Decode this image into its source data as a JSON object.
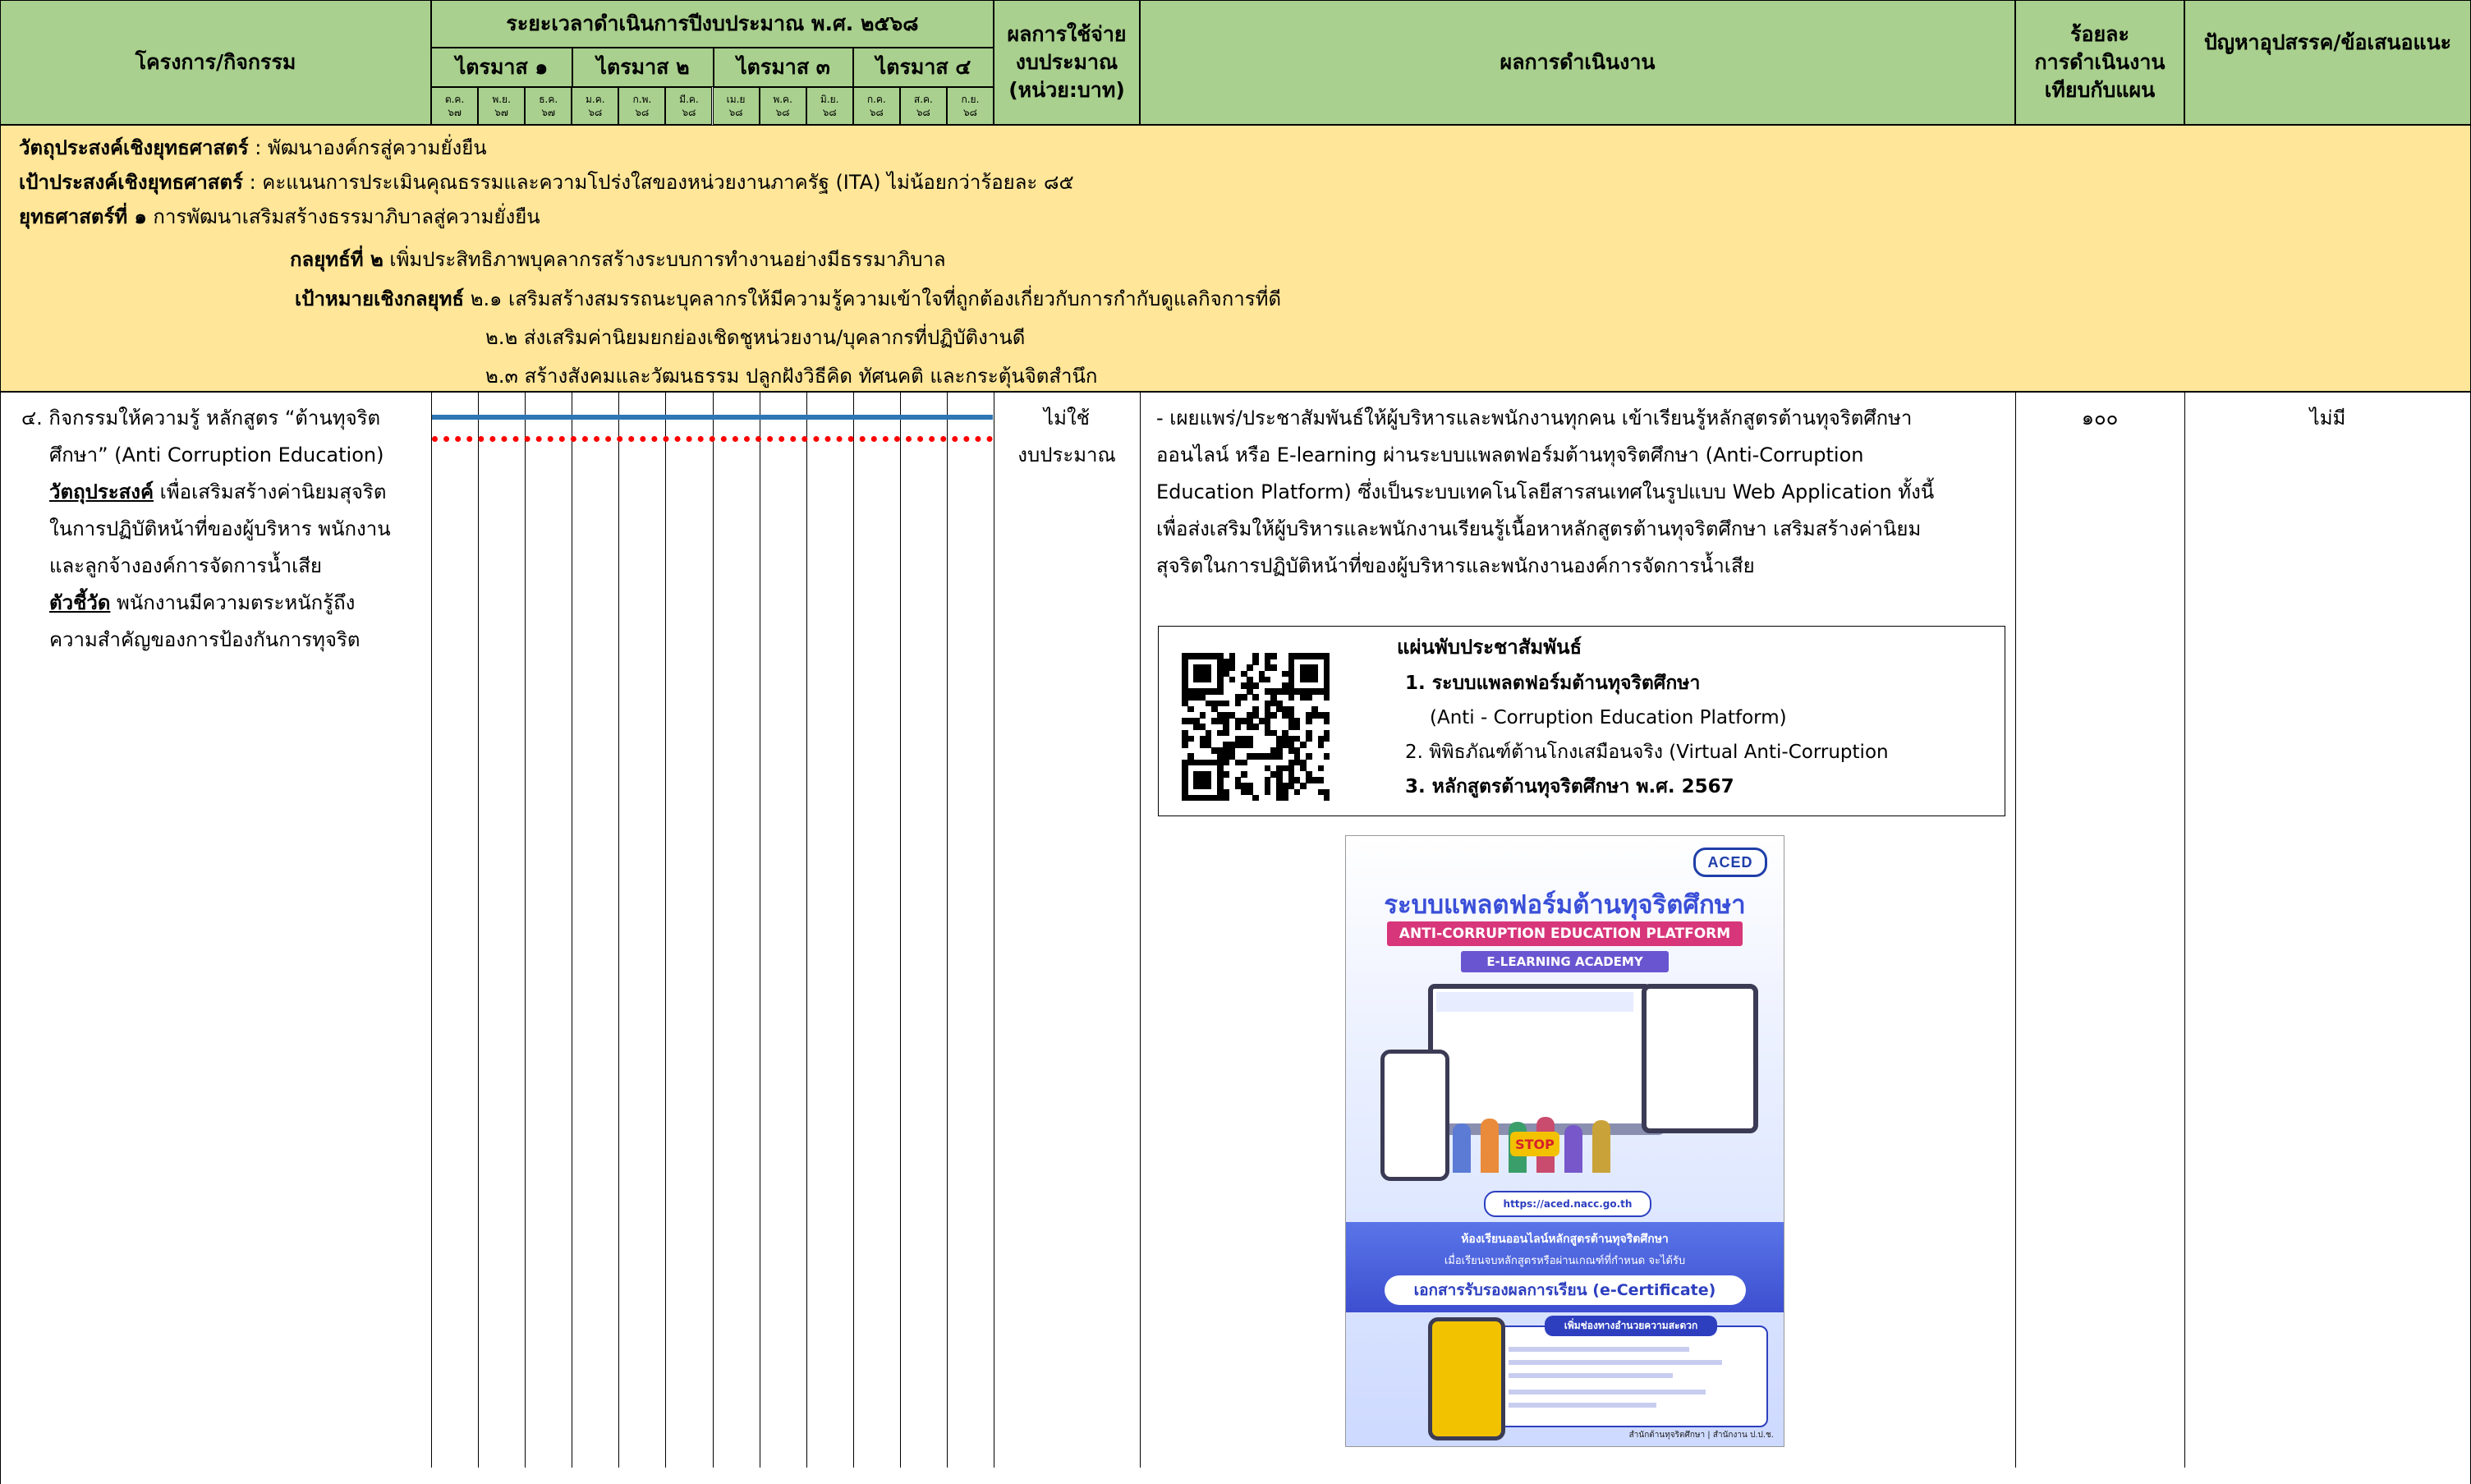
{
  "header": {
    "project_col": "โครงการ/กิจกรรม",
    "timeline_title": "ระยะเวลาดำเนินการปีงบประมาณ พ.ศ. ๒๕๖๘",
    "quarters": [
      "ไตรมาส ๑",
      "ไตรมาส ๒",
      "ไตรมาส ๓",
      "ไตรมาส ๔"
    ],
    "months": [
      "ต.ค.",
      "พ.ย.",
      "ธ.ค.",
      "ม.ค.",
      "ก.พ.",
      "มี.ค.",
      "เม.ย",
      "พ.ค.",
      "มิ.ย.",
      "ก.ค.",
      "ส.ค.",
      "ก.ย."
    ],
    "years": [
      "๖๗",
      "๖๗",
      "๖๗",
      "๖๘",
      "๖๘",
      "๖๘",
      "๖๘",
      "๖๘",
      "๖๘",
      "๖๘",
      "๖๘",
      "๖๘"
    ],
    "budget_l1": "ผลการใช้จ่าย",
    "budget_l2": "งบประมาณ",
    "budget_l3": "(หน่วย:บาท)",
    "result_col": "ผลการดำเนินงาน",
    "percent_l1": "ร้อยละ",
    "percent_l2": "การดำเนินงาน",
    "percent_l3": "เทียบกับแผน",
    "issue_col": "ปัญหาอุปสรรค/ข้อเสนอแนะ"
  },
  "strategy": {
    "objective_label": "วัตถุประสงค์เชิงยุทธศาสตร์",
    "objective_text": " : พัฒนาองค์กรสู่ความยั่งยืน",
    "target_label": "เป้าประสงค์เชิงยุทธศาสตร์",
    "target_text": "  : คะแนนการประเมินคุณธรรมและความโปร่งใสของหน่วยงานภาครัฐ (ITA) ไม่น้อยกว่าร้อยละ ๘๕",
    "strategy_label": "ยุทธศาสตร์ที่ ๑",
    "strategy_text": " การพัฒนาเสริมสร้างธรรมาภิบาลสู่ความยั่งยืน",
    "tactic_label": "กลยุทธ์ที่ ๒",
    "tactic_text": " เพิ่มประสิทธิภาพบุคลากรสร้างระบบการทำงานอย่างมีธรรมาภิบาล",
    "goal_label": "เป้าหมายเชิงกลยุทธ์",
    "goal_1": "  ๒.๑ เสริมสร้างสมรรถนะบุคลากรให้มีความรู้ความเข้าใจที่ถูกต้องเกี่ยวกับการกำกับดูแลกิจการที่ดี",
    "goal_2": "๒.๒ ส่งเสริมค่านิยมยกย่องเชิดชูหน่วยงาน/บุคลากรที่ปฏิบัติงานดี",
    "goal_3": "๒.๓ สร้างสังคมและวัฒนธรรม ปลูกฝังวิธีคิด ทัศนคติ และกระตุ้นจิตสำนึก"
  },
  "activity": {
    "line1": "๔. กิจกรรมให้ความรู้ หลักสูตร “ต้านทุจริต",
    "line2": "ศึกษา” (Anti Corruption Education)",
    "obj_label": "วัตถุประสงค์",
    "obj_line1": " เพื่อเสริมสร้างค่านิยมสุจริต",
    "obj_line2": "ในการปฏิบัติหน้าที่ของผู้บริหาร พนักงาน",
    "obj_line3": "และลูกจ้างองค์การจัดการน้ำเสีย",
    "kpi_label": "ตัวชี้วัด",
    "kpi_line1": " พนักงานมีความตระหนักรู้ถึง",
    "kpi_line2": "ความสำคัญของการป้องกันการทุจริต",
    "budget_l1": "ไม่ใช้",
    "budget_l2": "งบประมาณ",
    "result_lines": [
      "-  เผยแพร่/ประชาสัมพันธ์ให้ผู้บริหารและพนักงานทุกคน เข้าเรียนรู้หลักสูตรต้านทุจริตศึกษา",
      "ออนไลน์ หรือ E-learning ผ่านระบบแพลตฟอร์มต้านทุจริตศึกษา (Anti-Corruption",
      "Education Platform) ซึ่งเป็นระบบเทคโนโลยีสารสนเทศในรูปแบบ Web Application ทั้งนี้",
      "เพื่อส่งเสริมให้ผู้บริหารและพนักงานเรียนรู้เนื้อหาหลักสูตรต้านทุจริตศึกษา เสริมสร้างค่านิยม",
      "สุจริตในการปฏิบัติหน้าที่ของผู้บริหารและพนักงานองค์การจัดการน้ำเสีย"
    ],
    "percent": "๑๐๐",
    "issue": "ไม่มี"
  },
  "leaflet": {
    "title": "แผ่นพับประชาสัมพันธ์",
    "item1": "1. ระบบแพลตฟอร์มต้านทุจริตศึกษา",
    "item1b": "(Anti - Corruption Education Platform)",
    "item2": "2. พิพิธภัณฑ์ต้านโกงเสมือนจริง (Virtual Anti-Corruption",
    "item3": "3. หลักสูตรต้านทุจริตศึกษา พ.ศ. 2567"
  },
  "poster": {
    "logo": "ACED",
    "title_th": "ระบบแพลตฟอร์มต้านทุจริตศึกษา",
    "title_en": "ANTI-CORRUPTION EDUCATION PLATFORM",
    "subtitle": "E-LEARNING ACADEMY",
    "url": "https://aced.nacc.go.th",
    "course_line1": "ห้องเรียนออนไลน์หลักสูตรต้านทุจริตศึกษา",
    "course_line2": "เมื่อเรียนจบหลักสูตรหรือผ่านเกณฑ์ที่กำหนด จะได้รับ",
    "cert": "เอกสารรับรองผลการเรียน (e-Certificate)",
    "channel": "เพิ่มช่องทางอำนวยความสะดวก",
    "footer": "สำนักต้านทุจริตศึกษา | สำนักงาน ป.ป.ช."
  },
  "colors": {
    "header_green": "#a9d08e",
    "strategy_yellow": "#ffe699",
    "plan_line": "#2e75b6",
    "actual_line": "#ff0000"
  },
  "timeline_bar": {
    "plan_start_month": 1,
    "plan_end_month": 12,
    "actual_start_month": 1,
    "actual_end_month": 12
  }
}
